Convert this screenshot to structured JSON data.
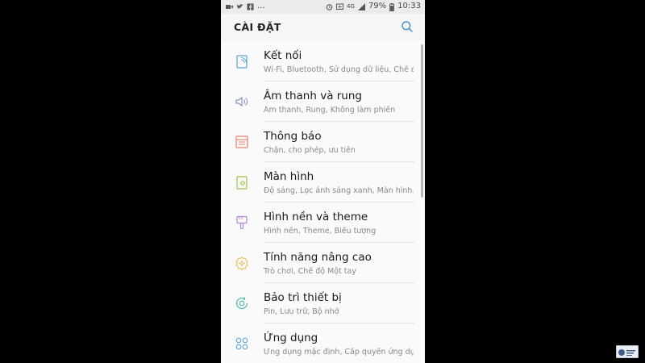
{
  "status_bar": {
    "battery": "79%",
    "time": "10:33",
    "overflow": "...",
    "network": "4G",
    "icons_left": [
      "video-icon",
      "twitter-icon",
      "facebook-icon"
    ],
    "icons_right": [
      "alarm-icon",
      "cast-icon",
      "signal-icon",
      "battery-icon"
    ]
  },
  "header": {
    "title": "CÀI ĐẶT",
    "search_icon": "search-icon"
  },
  "settings": [
    {
      "title": "Kết nối",
      "subtitle": "Wi-Fi, Bluetooth, Sử dụng dữ liệu, Chế độ",
      "icon": "connection-icon",
      "color": "#5aa6d6"
    },
    {
      "title": "Âm thanh và rung",
      "subtitle": "Âm thanh, Rung, Không làm phiền",
      "icon": "sound-icon",
      "color": "#7f93c9"
    },
    {
      "title": "Thông báo",
      "subtitle": "Chặn, cho phép, ưu tiên",
      "icon": "notification-icon",
      "color": "#ec7d6b"
    },
    {
      "title": "Màn hình",
      "subtitle": "Độ sáng, Lọc ánh sáng xanh, Màn hình...",
      "icon": "display-icon",
      "color": "#9ac24a"
    },
    {
      "title": "Hình nền và theme",
      "subtitle": "Hình nền, Theme, Biểu tượng",
      "icon": "wallpaper-icon",
      "color": "#b48ad6"
    },
    {
      "title": "Tính năng nâng cao",
      "subtitle": "Trò chơi, Chế độ Một tay",
      "icon": "advanced-features-icon",
      "color": "#e9c15a"
    },
    {
      "title": "Bảo trì thiết bị",
      "subtitle": "Pin, Lưu trữ, Bộ nhớ",
      "icon": "device-maintenance-icon",
      "color": "#4fb8a8"
    },
    {
      "title": "Ứng dụng",
      "subtitle": "Ứng dụng mặc định, Cấp quyền ứng dụng",
      "icon": "apps-icon",
      "color": "#5aa6d6"
    }
  ]
}
